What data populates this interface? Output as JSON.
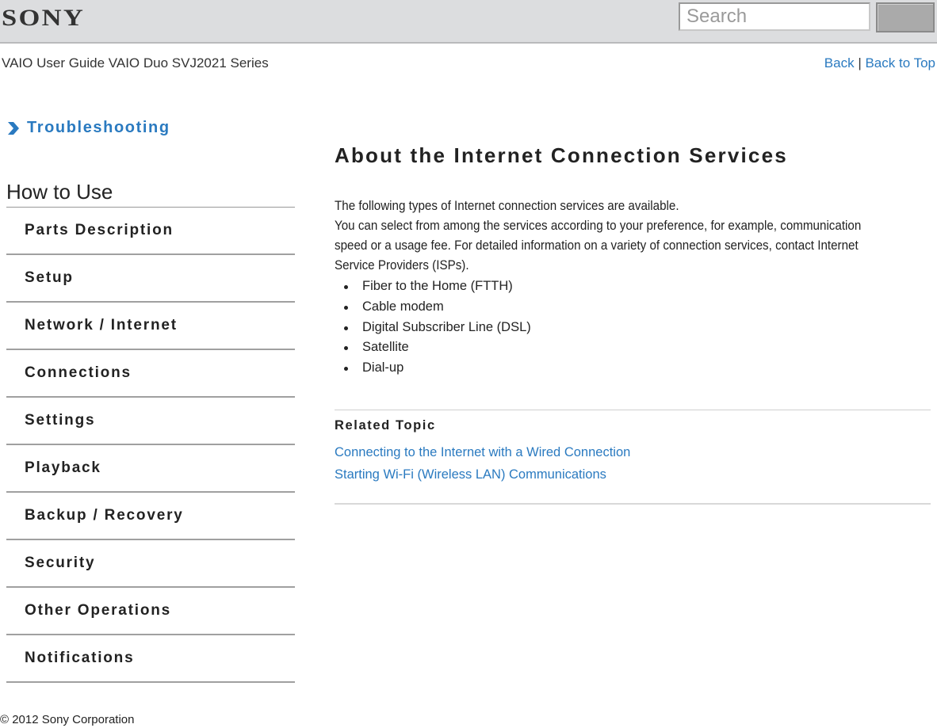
{
  "header": {
    "logo": "SONY",
    "search_placeholder": "Search",
    "search_button_label": ""
  },
  "subheader": {
    "guide_title": "VAIO User Guide VAIO Duo SVJ2021 Series",
    "back_label": "Back",
    "separator": "|",
    "back_to_top_label": "Back to Top"
  },
  "sidebar": {
    "troubleshooting_label": "Troubleshooting",
    "section_title": "How to Use",
    "items": [
      {
        "label": "Parts Description"
      },
      {
        "label": "Setup"
      },
      {
        "label": "Network / Internet"
      },
      {
        "label": "Connections"
      },
      {
        "label": "Settings"
      },
      {
        "label": "Playback"
      },
      {
        "label": "Backup / Recovery"
      },
      {
        "label": "Security"
      },
      {
        "label": "Other Operations"
      },
      {
        "label": "Notifications"
      }
    ]
  },
  "main": {
    "title": "About the Internet Connection Services",
    "paragraph_1": "The following types of Internet connection services are available.",
    "paragraph_2": "You can select from among the services according to your preference, for example, communication speed or a usage fee. For detailed information on a variety of connection services, contact Internet Service Providers (ISPs).",
    "bullets": [
      "Fiber to the Home (FTTH)",
      "Cable modem",
      "Digital Subscriber Line (DSL)",
      "Satellite",
      "Dial-up"
    ],
    "related_topic_title": "Related Topic",
    "related_links": [
      "Connecting to the Internet with a Wired Connection",
      "Starting Wi-Fi (Wireless LAN) Communications"
    ]
  },
  "footer": {
    "copyright": "© 2012 Sony Corporation"
  },
  "colors": {
    "link": "#2a7ac0",
    "header_bg": "#dcdddf",
    "text": "#222222"
  }
}
